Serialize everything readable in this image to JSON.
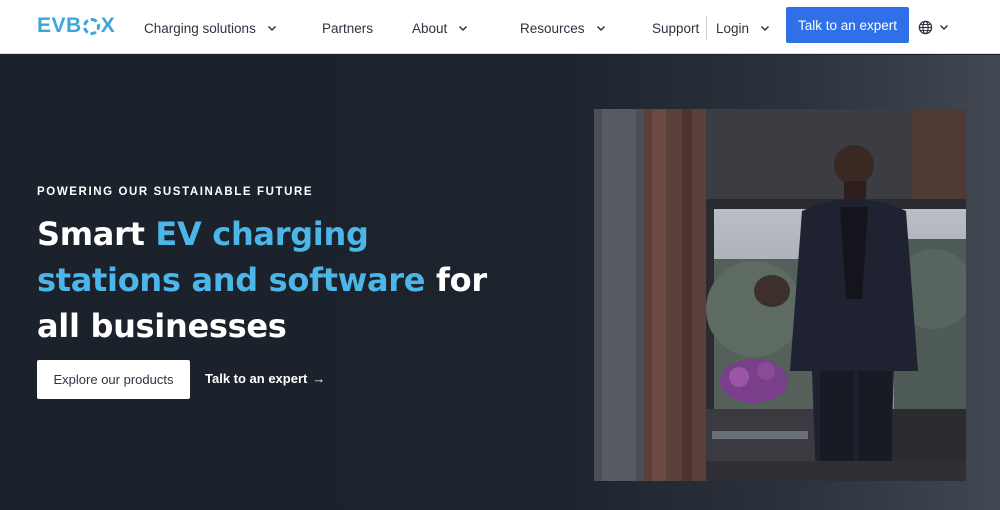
{
  "header": {
    "logo_text": "EVBOX",
    "nav": [
      {
        "label": "Charging solutions",
        "has_dropdown": true
      },
      {
        "label": "Partners",
        "has_dropdown": false
      },
      {
        "label": "About",
        "has_dropdown": true
      },
      {
        "label": "Resources",
        "has_dropdown": true
      },
      {
        "label": "Support",
        "has_dropdown": false
      },
      {
        "label": "Login",
        "has_dropdown": true
      }
    ],
    "cta_label": "Talk to an expert",
    "language_icon": "globe-icon"
  },
  "hero": {
    "eyebrow": "POWERING OUR SUSTAINABLE FUTURE",
    "headline_part1": "Smart ",
    "headline_highlight": "EV charging stations and software",
    "headline_part2": " for all businesses",
    "primary_button": "Explore our products",
    "secondary_link": "Talk to an expert",
    "secondary_link_icon": "arrow-right-icon"
  },
  "colors": {
    "accent_blue": "#2f6fe8",
    "highlight_blue": "#4db6e9",
    "hero_background": "#1d232c",
    "logo": "#3aa6dd"
  }
}
